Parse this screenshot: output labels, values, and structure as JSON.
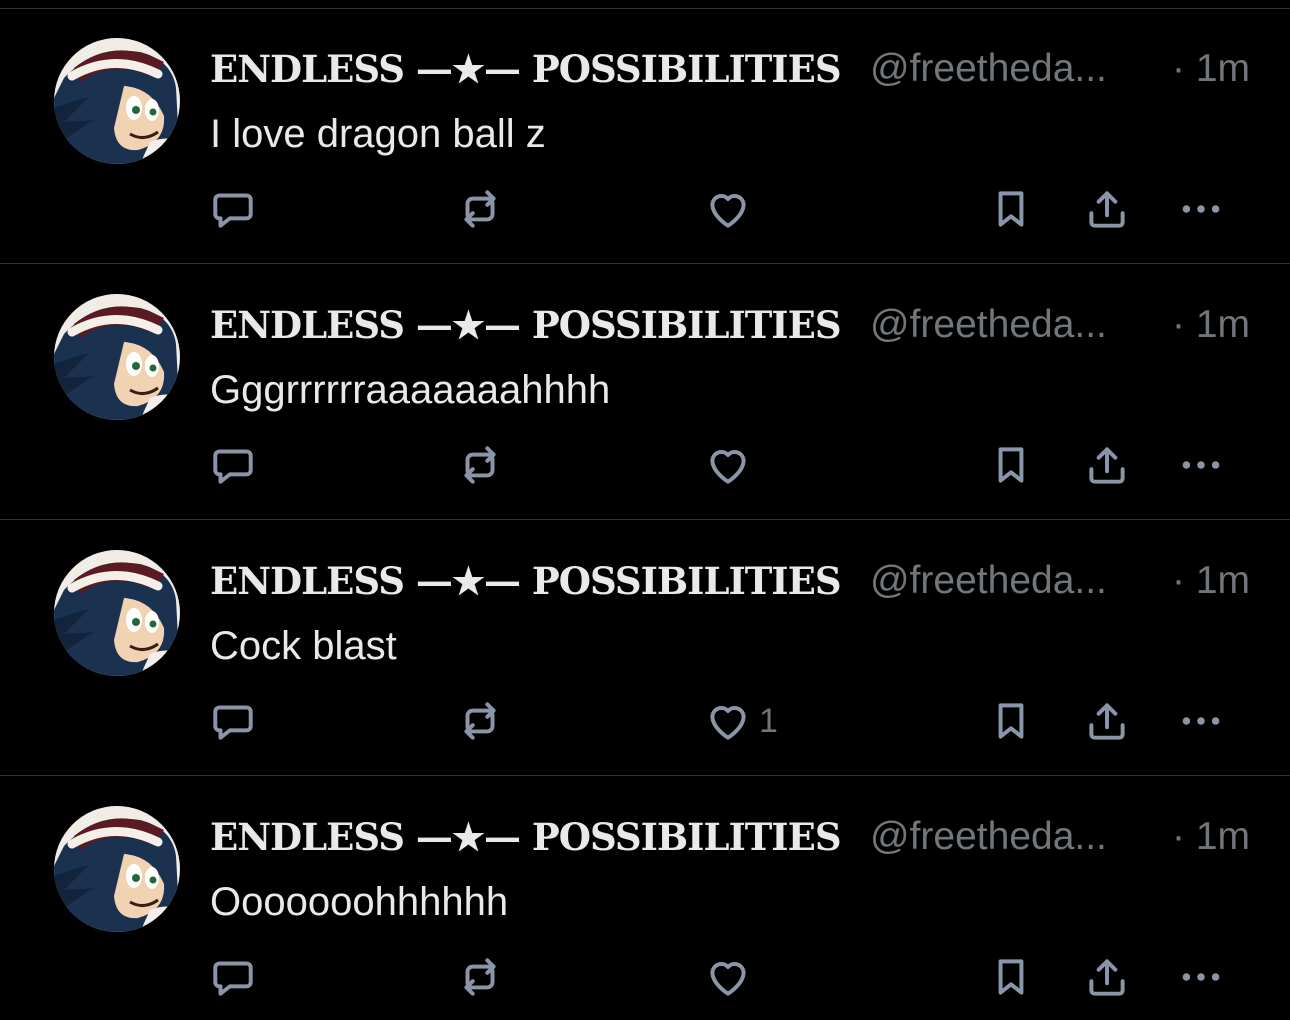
{
  "posts": [
    {
      "author_name": "ENDLESS —★— POSSIBILITIES",
      "handle": "@freetheda...",
      "time": "· 1m",
      "text": "I love dragon ball z",
      "like_count": ""
    },
    {
      "author_name": "ENDLESS —★— POSSIBILITIES",
      "handle": "@freetheda...",
      "time": "· 1m",
      "text": "Gggrrrrrraaaaaaahhhh",
      "like_count": ""
    },
    {
      "author_name": "ENDLESS —★— POSSIBILITIES",
      "handle": "@freetheda...",
      "time": "· 1m",
      "text": "Cock blast",
      "like_count": "1"
    },
    {
      "author_name": "ENDLESS —★— POSSIBILITIES",
      "handle": "@freetheda...",
      "time": "· 1m",
      "text": "Ooooooohhhhhh",
      "like_count": ""
    }
  ],
  "icons": {
    "reply": "reply-icon",
    "repost": "repost-icon",
    "like": "heart-icon",
    "bookmark": "bookmark-icon",
    "share": "share-icon",
    "more": "more-icon"
  },
  "colors": {
    "background": "#000000",
    "primary_text": "#e7e9ea",
    "secondary_text": "#71767b",
    "icon": "#8a96a8",
    "divider": "#2f3336"
  }
}
